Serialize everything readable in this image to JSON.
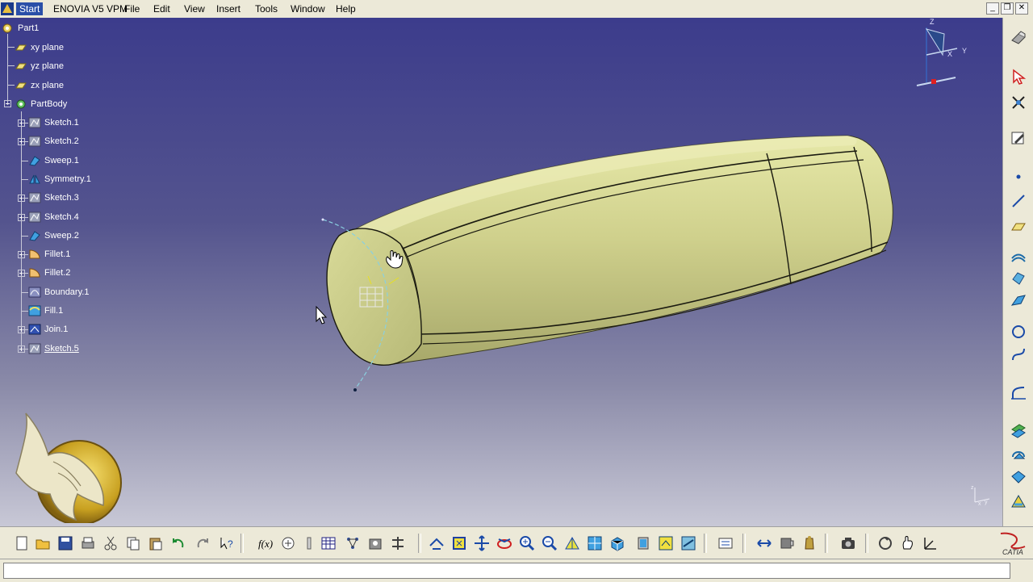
{
  "menubar": {
    "items": [
      "Start",
      "ENOVIA V5 VPM",
      "File",
      "Edit",
      "View",
      "Insert",
      "Tools",
      "Window",
      "Help"
    ],
    "active": "Start"
  },
  "window_controls": [
    "_",
    "❐",
    "✕"
  ],
  "tree": {
    "root": "Part1",
    "planes": [
      "xy plane",
      "yz plane",
      "zx plane"
    ],
    "body": "PartBody",
    "features": [
      {
        "label": "Sketch.1",
        "icon": "sketch-icon"
      },
      {
        "label": "Sketch.2",
        "icon": "sketch-icon"
      },
      {
        "label": "Sweep.1",
        "icon": "sweep-icon"
      },
      {
        "label": "Symmetry.1",
        "icon": "symmetry-icon"
      },
      {
        "label": "Sketch.3",
        "icon": "sketch-icon"
      },
      {
        "label": "Sketch.4",
        "icon": "sketch-icon"
      },
      {
        "label": "Sweep.2",
        "icon": "sweep-icon"
      },
      {
        "label": "Fillet.1",
        "icon": "fillet-icon"
      },
      {
        "label": "Fillet.2",
        "icon": "fillet-icon"
      },
      {
        "label": "Boundary.1",
        "icon": "boundary-icon"
      },
      {
        "label": "Fill.1",
        "icon": "fill-icon"
      },
      {
        "label": "Join.1",
        "icon": "join-icon"
      },
      {
        "label": "Sketch.5",
        "icon": "sketch-icon"
      }
    ],
    "selected": "Sketch.5"
  },
  "compass": {
    "axis_x": "X",
    "axis_y": "Y",
    "axis_z": "Z"
  },
  "mini_axis": {
    "x": "x",
    "y": "y",
    "z": "z"
  },
  "colors": {
    "viewport_top": "#3c3c8c",
    "viewport_bottom": "#c8c8d6",
    "part_surface": "#cfd08c",
    "toolbar_bg": "#ece9d8"
  },
  "right_toolbar": [
    "render-icon",
    "select-arrow-icon",
    "snap-icon",
    "sketcher-icon",
    "point-icon",
    "line-icon",
    "plane-icon",
    "extrude-icon",
    "revolve-icon",
    "sweep-surface-icon",
    "circle-icon",
    "spline-icon",
    "corner-icon",
    "offset-icon",
    "rotate-icon",
    "fill-surface-icon",
    "blend-icon"
  ],
  "bottom_toolbar": [
    "new-icon",
    "open-icon",
    "save-icon",
    "print-icon",
    "cut-icon",
    "copy-icon",
    "paste-icon",
    "undo-icon",
    "redo-icon",
    "whats-this-icon",
    "formula-icon",
    "knowledge-icon",
    "law-icon",
    "table-icon",
    "parameters-icon",
    "catalog-icon",
    "hierarchy-icon",
    "fly-icon",
    "fit-all-icon",
    "pan-icon",
    "rotate-view-icon",
    "zoom-in-icon",
    "zoom-out-icon",
    "normal-view-icon",
    "multi-view-icon",
    "iso-view-icon",
    "shading-icon",
    "hide-show-icon",
    "swap-icon",
    "measure-icon",
    "analysis-icon",
    "mass-icon",
    "capture-icon",
    "update-icon",
    "manipulation-icon",
    "axis-system-icon",
    "spec-tree-icon"
  ],
  "brand": "CATIA"
}
